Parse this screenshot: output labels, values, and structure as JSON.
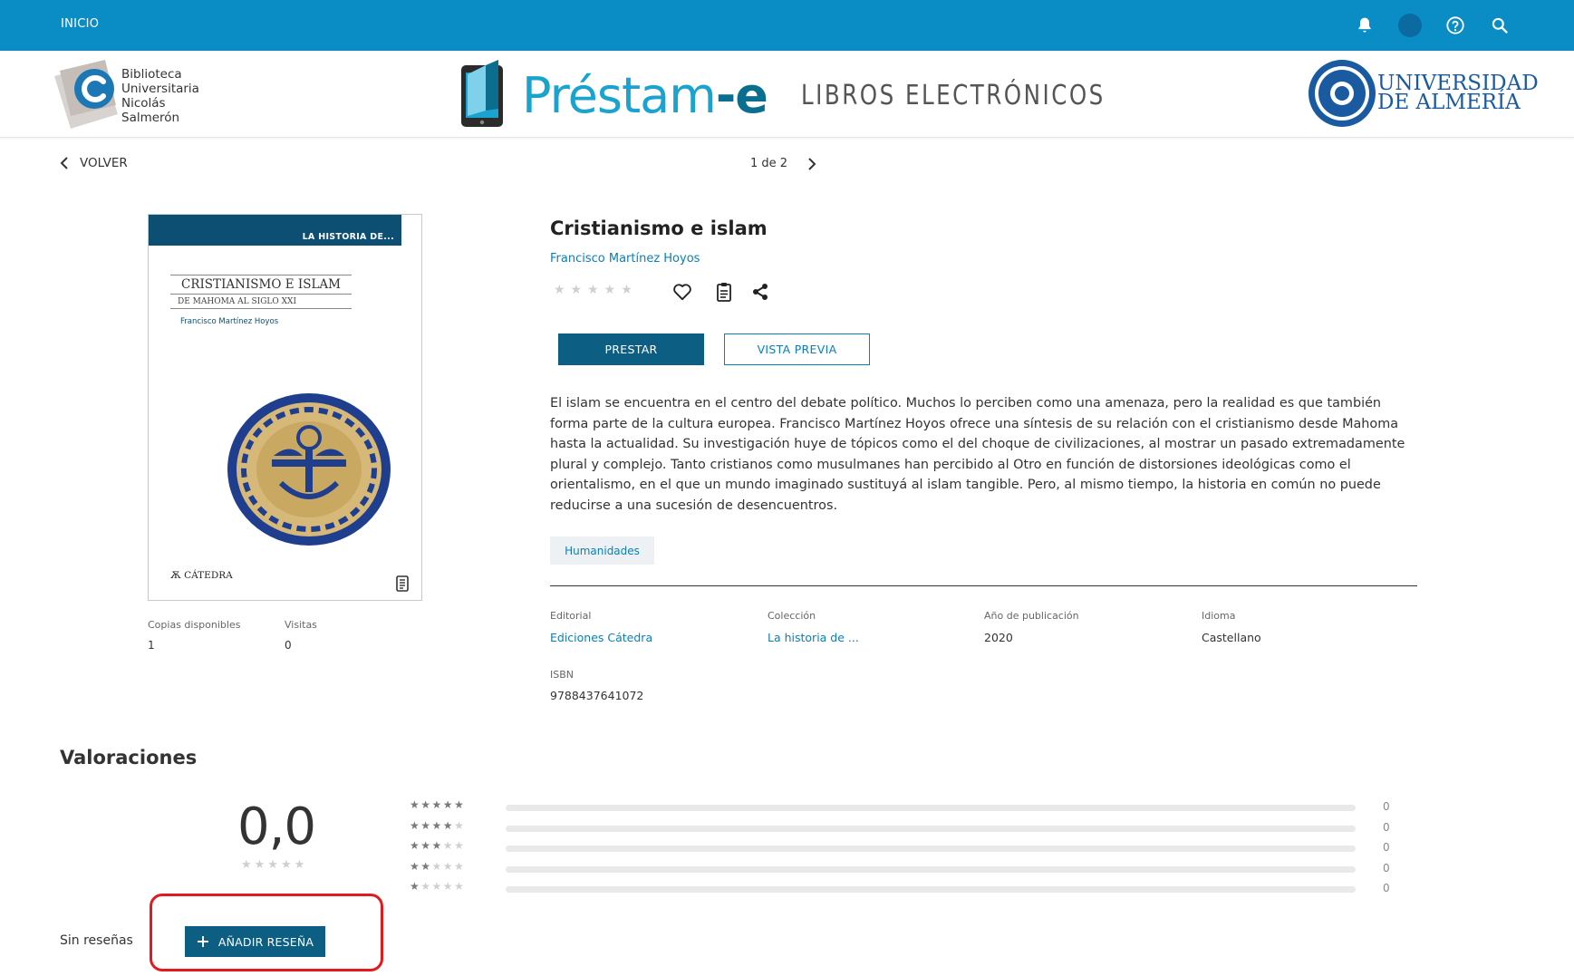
{
  "topbar": {
    "home_label": "INICIO"
  },
  "header": {
    "library_name": [
      "Biblioteca",
      "Universitaria",
      "Nicolás",
      "Salmerón"
    ],
    "brand_main": "Préstam",
    "brand_suffix": "-e",
    "brand_tagline": "LIBROS ELECTRÓNICOS",
    "university": [
      "UNIVERSIDAD",
      "DE ALMERÍA"
    ]
  },
  "nav": {
    "back_label": "VOLVER",
    "pager": "1 de 2"
  },
  "cover": {
    "series": "LA HISTORIA DE...",
    "title": "CRISTIANISMO E ISLAM",
    "subtitle": "DE MAHOMA AL SIGLO XXI",
    "author": "Francisco Martínez Hoyos",
    "publisher_mark": "CÁTEDRA"
  },
  "stats": {
    "copies_label": "Copias disponibles",
    "copies_value": "1",
    "visits_label": "Visitas",
    "visits_value": "0"
  },
  "book": {
    "title": "Cristianismo e islam",
    "author": "Francisco Martínez Hoyos",
    "rating_stars": "★★★★★",
    "lend_label": "PRESTAR",
    "preview_label": "VISTA PREVIA",
    "description": "El islam se encuentra en el centro del debate político. Muchos lo perciben como una amenaza, pero la realidad es que también forma parte de la cultura europea. Francisco Martínez Hoyos ofrece una síntesis de su relación con el cristianismo desde Mahoma hasta la actualidad. Su investigación huye de tópicos como el del choque de civilizaciones, al mostrar un pasado extremadamente plural y complejo. Tanto cristianos como musulmanes han percibido al Otro en función de distorsiones ideológicas como el orientalismo, en el que un mundo imaginado sustituyá al islam tangible. Pero, al mismo tiempo, la historia en común no puede reducirse a una sucesión de desencuentros.",
    "tag": "Humanidades"
  },
  "meta": {
    "editorial_label": "Editorial",
    "editorial_value": "Ediciones Cátedra",
    "coleccion_label": "Colección",
    "coleccion_value": "La historia de ...",
    "anio_label": "Año de publicación",
    "anio_value": "2020",
    "idioma_label": "Idioma",
    "idioma_value": "Castellano",
    "isbn_label": "ISBN",
    "isbn_value": "9788437641072"
  },
  "ratings": {
    "title": "Valoraciones",
    "average": "0,0",
    "average_stars": "★★★★★",
    "rows": [
      {
        "stars": 5,
        "count": "0",
        "fraction": 0
      },
      {
        "stars": 4,
        "count": "0",
        "fraction": 0
      },
      {
        "stars": 3,
        "count": "0",
        "fraction": 0
      },
      {
        "stars": 2,
        "count": "0",
        "fraction": 0
      },
      {
        "stars": 1,
        "count": "0",
        "fraction": 0
      }
    ],
    "no_reviews": "Sin reseñas",
    "add_review_label": "AÑADIR RESEÑA"
  },
  "colors": {
    "topbar": "#0a8cc4",
    "primary_button": "#0d5e83",
    "link": "#0a7fb7",
    "highlight": "#e3191b"
  }
}
